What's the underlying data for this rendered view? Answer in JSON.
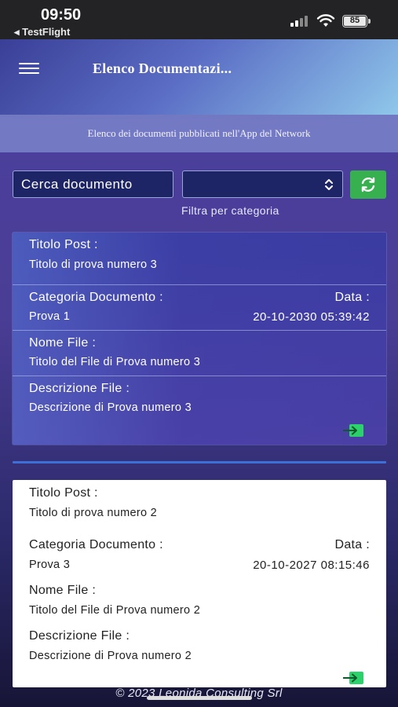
{
  "status_bar": {
    "time": "09:50",
    "back_app": "◂ TestFlight",
    "battery": "85"
  },
  "header": {
    "title": "Elenco Documentazi...",
    "subtitle": "Elenco dei documenti pubblicati nell'App del Network",
    "menu_icon": "hamburger-menu-icon"
  },
  "filters": {
    "search_placeholder": "Cerca documento",
    "category_value": "",
    "category_label": "Filtra per categoria",
    "refresh_icon": "refresh-icon",
    "colors": {
      "refresh": "#37b04f",
      "input_bg": "#1e2566"
    }
  },
  "labels": {
    "post_title": "Titolo Post :",
    "category": "Categoria Documento :",
    "date": "Data :",
    "file_name": "Nome File :",
    "file_description": "Descrizione File :"
  },
  "documents": [
    {
      "post_title": "Titolo di prova numero 3",
      "category": "Prova 1",
      "date": "20-10-2030 05:39:42",
      "file_name": "Titolo del File di Prova numero 3",
      "file_description": "Descrizione di Prova numero 3",
      "action_icon": "open-file-icon"
    },
    {
      "post_title": "Titolo di prova numero 2",
      "category": "Prova 3",
      "date": "20-10-2027 08:15:46",
      "file_name": "Titolo del File di Prova numero 2",
      "file_description": "Descrizione di Prova numero 2",
      "action_icon": "open-file-icon"
    }
  ],
  "footer": {
    "copyright": "© 2023 Leonida Consulting Srl"
  },
  "colors": {
    "accent_green": "#2bd16a",
    "separator_blue": "#3c6fd8"
  }
}
